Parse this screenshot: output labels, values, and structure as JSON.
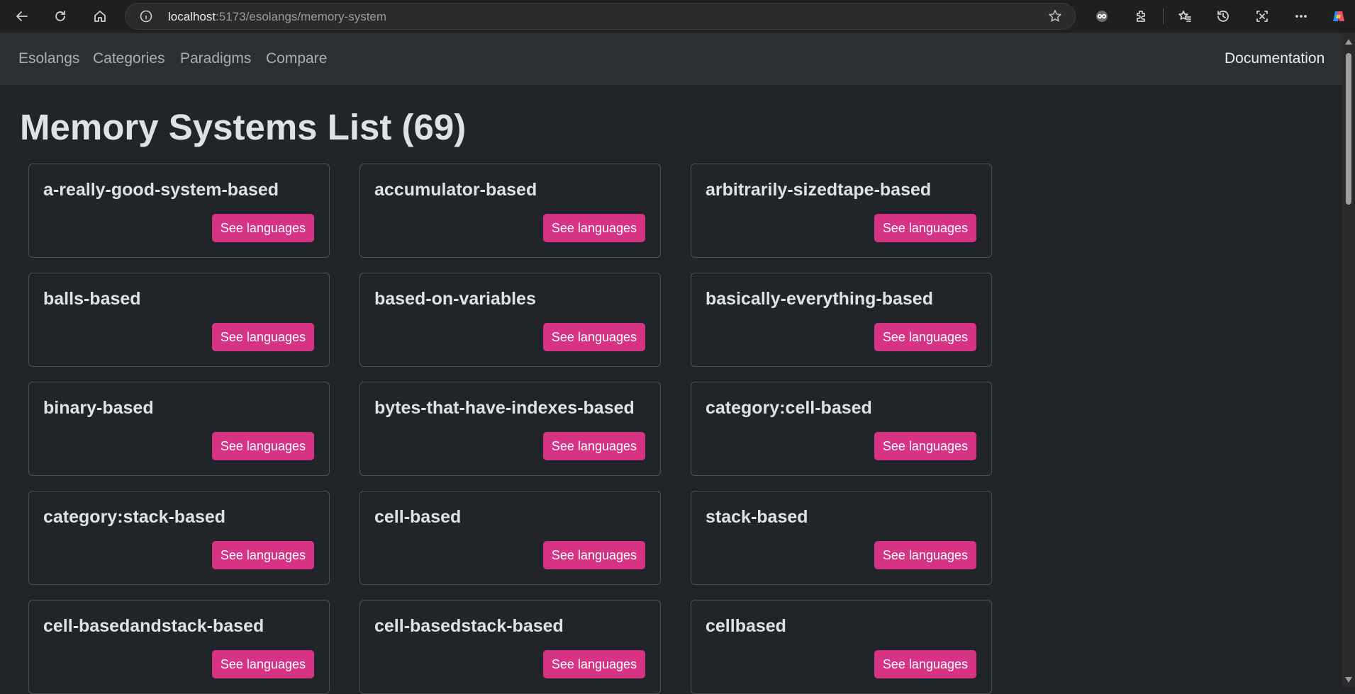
{
  "browser": {
    "url_host": "localhost",
    "url_rest": ":5173/esolangs/memory-system"
  },
  "nav": {
    "links": [
      "Esolangs",
      "Categories",
      "Paradigms",
      "Compare"
    ],
    "right_link": "Documentation"
  },
  "page": {
    "title": "Memory Systems List (69)"
  },
  "cards": [
    {
      "name": "a-really-good-system-based",
      "button": "See languages"
    },
    {
      "name": "accumulator-based",
      "button": "See languages"
    },
    {
      "name": "arbitrarily-sizedtape-based",
      "button": "See languages"
    },
    {
      "name": "balls-based",
      "button": "See languages"
    },
    {
      "name": "based-on-variables",
      "button": "See languages"
    },
    {
      "name": "basically-everything-based",
      "button": "See languages"
    },
    {
      "name": "binary-based",
      "button": "See languages"
    },
    {
      "name": "bytes-that-have-indexes-based",
      "button": "See languages"
    },
    {
      "name": "category:cell-based",
      "button": "See languages"
    },
    {
      "name": "category:stack-based",
      "button": "See languages"
    },
    {
      "name": "cell-based",
      "button": "See languages"
    },
    {
      "name": "stack-based",
      "button": "See languages"
    },
    {
      "name": "cell-basedandstack-based",
      "button": "See languages"
    },
    {
      "name": "cell-basedstack-based",
      "button": "See languages"
    },
    {
      "name": "cellbased",
      "button": "See languages"
    }
  ],
  "colors": {
    "background": "#212529",
    "navbar": "#2b3035",
    "accent": "#d63384",
    "card_border": "#495057"
  },
  "icons": [
    "back-arrow-icon",
    "refresh-icon",
    "home-icon",
    "info-icon",
    "star-icon",
    "profile-icon",
    "extensions-icon",
    "favorites-icon",
    "history-icon",
    "screenshot-icon",
    "more-icon",
    "copilot-icon"
  ]
}
